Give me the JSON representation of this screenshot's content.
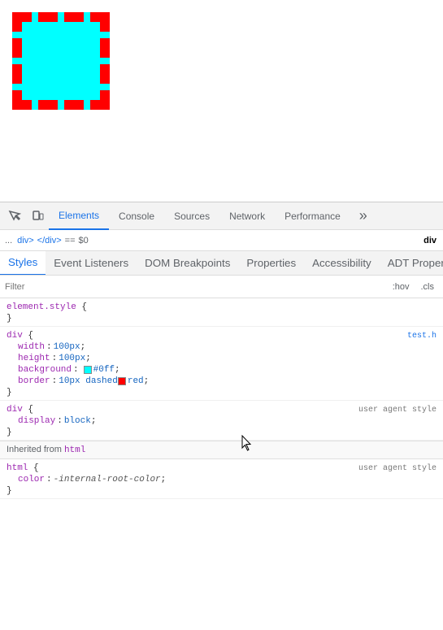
{
  "preview": {
    "box_bg": "cyan",
    "box_border_color": "red",
    "box_border_style": "dashed"
  },
  "devtools": {
    "toolbar": {
      "icon_inspect": "⬡",
      "icon_mobile": "□"
    },
    "tabs": [
      {
        "label": "Elements",
        "active": true
      },
      {
        "label": "Console",
        "active": false
      },
      {
        "label": "Sources",
        "active": false
      },
      {
        "label": "Network",
        "active": false
      },
      {
        "label": "Performance",
        "active": false
      }
    ],
    "tab_overflow_label": "»",
    "breadcrumb": {
      "dots": "...",
      "items": [
        {
          "label": "div>",
          "tag": "div",
          "suffix": ">",
          "active": false
        },
        {
          "label": "</div>",
          "tag": "/div",
          "suffix": "",
          "active": false
        }
      ],
      "eq_sign": "==",
      "dollar_zero": "$0",
      "active_item": "div"
    },
    "style_tabs": [
      {
        "label": "Styles",
        "active": true
      },
      {
        "label": "Event Listeners",
        "active": false
      },
      {
        "label": "DOM Breakpoints",
        "active": false
      },
      {
        "label": "Properties",
        "active": false
      },
      {
        "label": "Accessibility",
        "active": false
      },
      {
        "label": "ADT Properti...",
        "active": false
      }
    ],
    "filter": {
      "placeholder": "Filter",
      "hov_btn": ":hov",
      "cls_btn": ".cls"
    },
    "styles": [
      {
        "id": "element-style",
        "selector": "element.style",
        "brace_open": " {",
        "brace_close": "}",
        "file": "",
        "properties": []
      },
      {
        "id": "div-rule",
        "selector": "div",
        "brace_open": " {",
        "brace_close": "}",
        "file": "test.h",
        "file_full": "test.h",
        "properties": [
          {
            "name": "width",
            "colon": ":",
            "value": "100px",
            "semicolon": ";",
            "color": null
          },
          {
            "name": "height",
            "colon": ":",
            "value": "100px",
            "semicolon": ";",
            "color": null
          },
          {
            "name": "background",
            "colon": ":",
            "value": "#0ff",
            "semicolon": ";",
            "color": "#00ffff",
            "has_swatch": true,
            "swatch_color": "#00ffff"
          },
          {
            "name": "border",
            "colon": ":",
            "value": "10px dashed",
            "semicolon": "",
            "color": null,
            "has_swatch": true,
            "swatch_color": "red",
            "after_swatch": " red;"
          }
        ]
      },
      {
        "id": "div-useragent",
        "selector": "div",
        "brace_open": " {",
        "brace_close": "}",
        "file": "user agent style",
        "properties": [
          {
            "name": "display",
            "colon": ":",
            "value": "block",
            "semicolon": ";",
            "color": null
          }
        ]
      }
    ],
    "inherited_label": "Inherited from",
    "inherited_tag": "html",
    "html_rule": {
      "selector": "html",
      "brace_open": " {",
      "brace_close": "}",
      "file": "user agent style",
      "properties": [
        {
          "name": "color",
          "colon": ":",
          "value": "-internal-root-color",
          "semicolon": ";",
          "italic": true
        }
      ]
    }
  }
}
